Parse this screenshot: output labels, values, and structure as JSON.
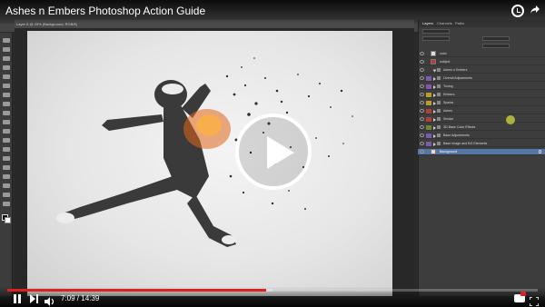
{
  "video": {
    "title": "Ashes n Embers Photoshop Action Guide",
    "current_time": "7:09",
    "duration": "14:39",
    "time_separator": " / ",
    "progress_fraction": 0.488,
    "buffered_fraction": 0.5
  },
  "photoshop": {
    "document_tab": "Layer 8 @ 25% (Background, RGB/8)",
    "panel_tabs": [
      "Layers",
      "Channels",
      "Paths"
    ],
    "layers": [
      {
        "name": "color",
        "type": "layer",
        "tag": ""
      },
      {
        "name": "subject",
        "type": "layer",
        "tag": "",
        "thumb": "red"
      },
      {
        "name": "Ashes n Embers",
        "type": "group",
        "tag": ""
      },
      {
        "name": "Overall Adjustments",
        "type": "group",
        "tag": "#7a5bb0"
      },
      {
        "name": "Toning",
        "type": "group",
        "tag": "#7a5bb0"
      },
      {
        "name": "Embers",
        "type": "group",
        "tag": "#b6a02a"
      },
      {
        "name": "Sparks",
        "type": "group",
        "tag": "#b6a02a"
      },
      {
        "name": "Ashes",
        "type": "group",
        "tag": "#b04040"
      },
      {
        "name": "Smoke",
        "type": "group",
        "tag": "#b04040"
      },
      {
        "name": "3D Base Color Effects",
        "type": "group",
        "tag": "#6a8a30"
      },
      {
        "name": "Base Adjustments",
        "type": "group",
        "tag": "#7a5bb0"
      },
      {
        "name": "Base Image and BG Elements",
        "type": "group",
        "tag": "#7a5bb0"
      },
      {
        "name": "Background",
        "type": "layer",
        "tag": "",
        "selected": true,
        "locked": true
      }
    ],
    "colors": {
      "selection": "#5577a6",
      "progress": "#e02020"
    }
  },
  "icons": [
    "clock-icon",
    "share-icon",
    "play-icon",
    "pause-icon",
    "next-icon",
    "volume-icon",
    "cc-icon",
    "fullscreen-icon"
  ]
}
